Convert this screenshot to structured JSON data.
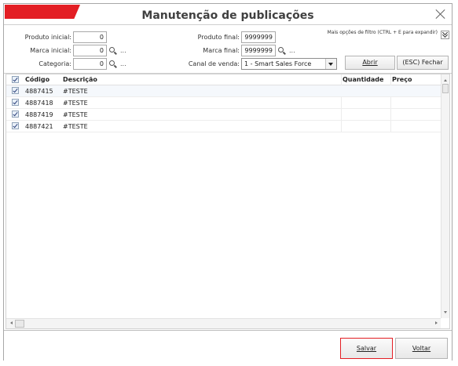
{
  "window": {
    "title": "Manutenção de publicações",
    "accent_color": "#e31e24",
    "close_icon": "close-icon"
  },
  "filters": {
    "produto_inicial": {
      "label": "Produto inicial:",
      "value": "0"
    },
    "marca_inicial": {
      "label": "Marca inicial:",
      "value": "0"
    },
    "categoria": {
      "label": "Categoria:",
      "value": "0"
    },
    "produto_final": {
      "label": "Produto final:",
      "value": "9999999"
    },
    "marca_final": {
      "label": "Marca final:",
      "value": "9999999"
    },
    "canal": {
      "label": "Canal de venda:",
      "value": "1 - Smart Sales Force"
    },
    "lookup_dots": "...",
    "more_options": "Mais opções de filtro (CTRL + E para expandir)",
    "abrir_label": "Abrir",
    "fechar_label": "(ESC) Fechar"
  },
  "grid": {
    "headers": {
      "codigo": "Código",
      "descricao": "Descrição",
      "quantidade": "Quantidade",
      "preco": "Preço"
    },
    "rows": [
      {
        "checked": true,
        "codigo": "4887415",
        "descricao": "#TESTE"
      },
      {
        "checked": true,
        "codigo": "4887418",
        "descricao": "#TESTE"
      },
      {
        "checked": true,
        "codigo": "4887419",
        "descricao": "#TESTE"
      },
      {
        "checked": true,
        "codigo": "4887421",
        "descricao": "#TESTE"
      }
    ]
  },
  "footer": {
    "salvar_label": "Salvar",
    "voltar_label": "Voltar",
    "salvar_border_color": "#e31e24"
  }
}
